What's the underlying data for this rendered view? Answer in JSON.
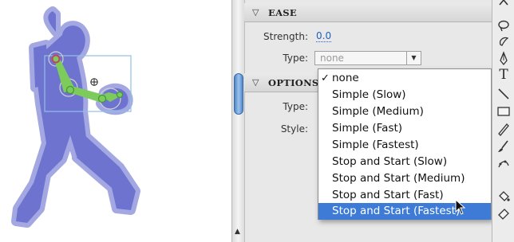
{
  "ease": {
    "header": "EASE",
    "strength_label": "Strength:",
    "strength_value": "0.0",
    "type_label": "Type:",
    "type_value": "none"
  },
  "options": {
    "header": "OPTIONS",
    "type_label": "Type:",
    "style_label": "Style:"
  },
  "dropdown": {
    "items": [
      "none",
      "Simple (Slow)",
      "Simple (Medium)",
      "Simple (Fast)",
      "Simple (Fastest)",
      "Stop and Start (Slow)",
      "Stop and Start (Medium)",
      "Stop and Start (Fast)",
      "Stop and Start (Fastest)"
    ],
    "checked_item": "none",
    "highlighted_item": "Stop and Start (Fastest)"
  },
  "colors": {
    "figure_fill": "#6e73cf",
    "figure_outline": "#a4a8e2",
    "bones": "#7ccb5c",
    "bone_joint": "#3f9a2f",
    "selection_box": "#8ec1e6",
    "highlight": "#3d7bd6"
  },
  "tools": [
    "scroll-up-icon",
    "lasso-icon",
    "subselect-icon",
    "pen-icon",
    "text-icon",
    "line-icon",
    "rectangle-icon",
    "pencil-icon",
    "brush-icon",
    "deco-icon",
    "paint-bucket-icon",
    "eraser-icon"
  ],
  "scroll_arrow": "▲",
  "section_toggle_glyph": "▽",
  "text_tool_glyph": "T"
}
